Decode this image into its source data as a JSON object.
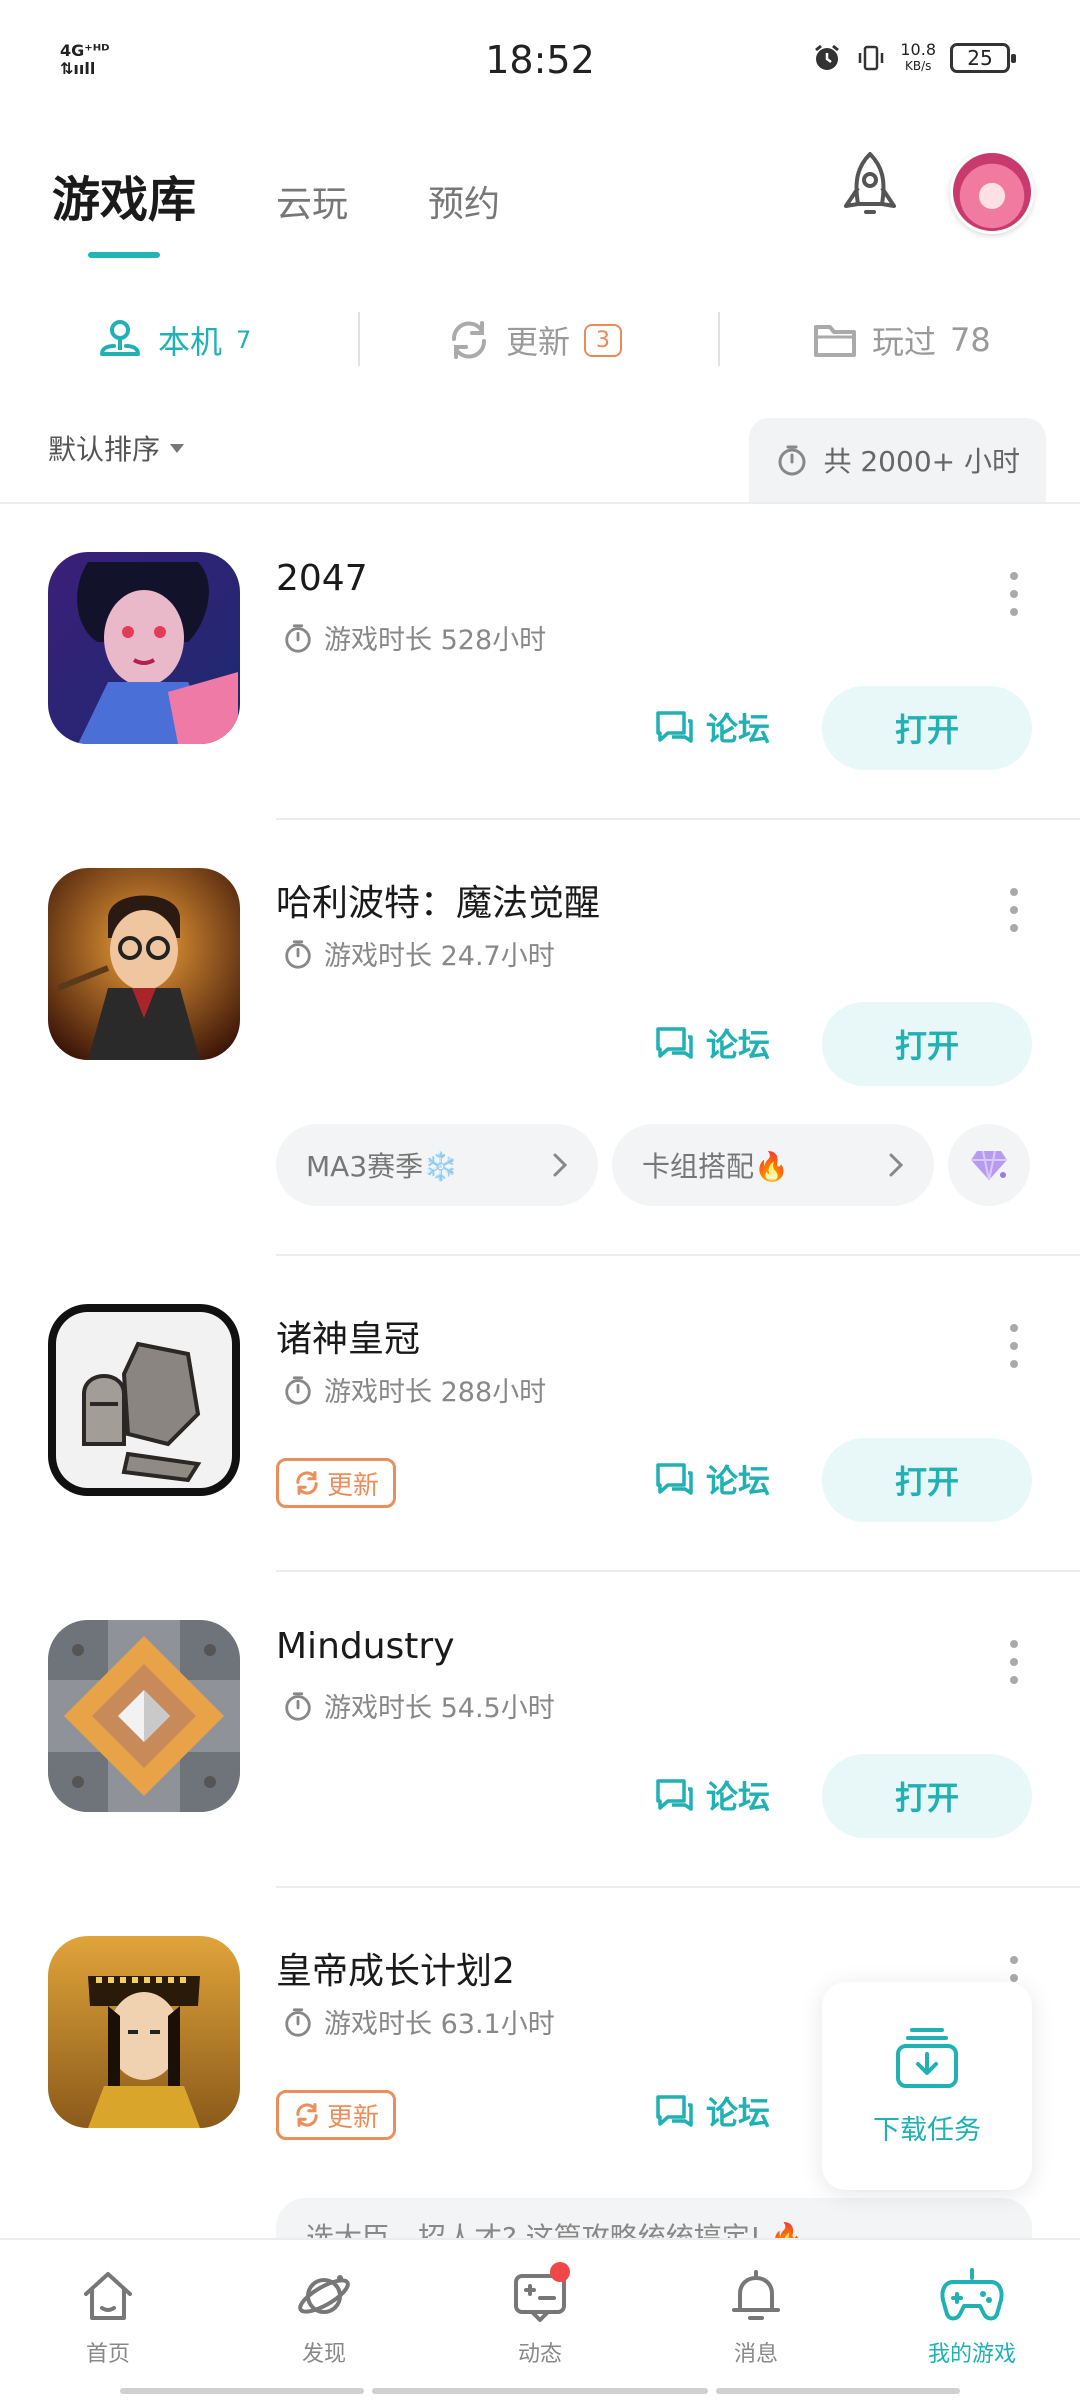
{
  "status_bar": {
    "network_line1": "4G⁺ᴴᴰ",
    "network_line2": "⇅ııll",
    "time": "18:52",
    "speed_value": "10.8",
    "speed_unit": "KB/s",
    "battery": "25"
  },
  "header": {
    "tabs": [
      {
        "label": "游戏库",
        "active": true
      },
      {
        "label": "云玩",
        "active": false
      },
      {
        "label": "预约",
        "active": false
      }
    ],
    "accent_color": "#1fb1b3"
  },
  "filters": [
    {
      "label": "本机",
      "count": "7",
      "icon": "device-icon",
      "active": true
    },
    {
      "label": "更新",
      "count": "3",
      "icon": "refresh-icon",
      "active": false
    },
    {
      "label": "玩过",
      "count": "78",
      "icon": "folder-icon",
      "active": false
    }
  ],
  "sort": {
    "label": "默认排序"
  },
  "total_time": {
    "label": "共 2000+ 小时"
  },
  "games": [
    {
      "title": "2047",
      "playtime": "游戏时长 528小时",
      "forum": "论坛",
      "open": "打开"
    },
    {
      "title": "哈利波特：魔法觉醒",
      "playtime": "游戏时长 24.7小时",
      "forum": "论坛",
      "open": "打开",
      "chips": [
        {
          "label": "MA3赛季❄️"
        },
        {
          "label": "卡组搭配🔥"
        }
      ]
    },
    {
      "title": "诸神皇冠",
      "playtime": "游戏时长 288小时",
      "forum": "论坛",
      "open": "打开",
      "update": "更新"
    },
    {
      "title": "Mindustry",
      "playtime": "游戏时长 54.5小时",
      "forum": "论坛",
      "open": "打开"
    },
    {
      "title": "皇帝成长计划2",
      "playtime": "游戏时长 63.1小时",
      "forum": "论坛",
      "update": "更新",
      "partial_chip": "选大臣、招人才? 这篇攻略统统搞定! 🔥"
    }
  ],
  "download_card": {
    "label": "下载任务"
  },
  "bottom_nav": [
    {
      "label": "首页",
      "icon": "home-icon"
    },
    {
      "label": "发现",
      "icon": "planet-icon"
    },
    {
      "label": "动态",
      "icon": "chat-icon"
    },
    {
      "label": "消息",
      "icon": "bell-icon"
    },
    {
      "label": "我的游戏",
      "icon": "gamepad-icon",
      "active": true
    }
  ]
}
